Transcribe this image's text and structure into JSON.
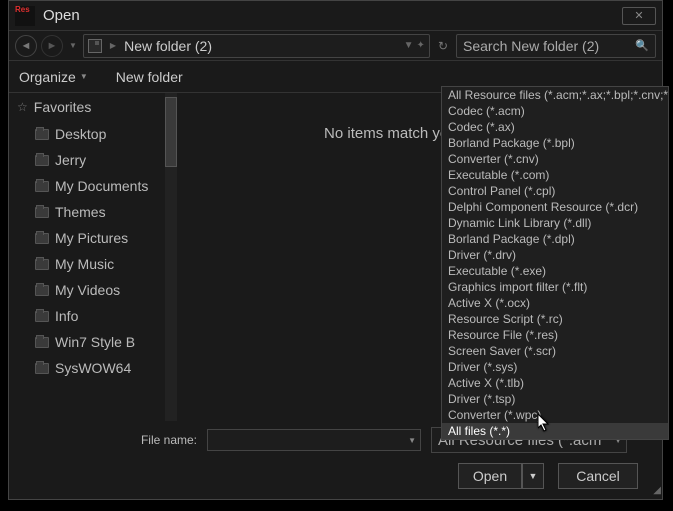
{
  "window": {
    "title": "Open"
  },
  "breadcrumb": {
    "location": "New folder (2)"
  },
  "search": {
    "placeholder": "Search New folder (2)"
  },
  "toolbar": {
    "organize": "Organize",
    "newfolder": "New folder"
  },
  "sidebar": {
    "header": "Favorites",
    "items": [
      {
        "label": "Desktop"
      },
      {
        "label": "Jerry"
      },
      {
        "label": "My Documents"
      },
      {
        "label": "Themes"
      },
      {
        "label": "My Pictures"
      },
      {
        "label": "My Music"
      },
      {
        "label": "My Videos"
      },
      {
        "label": "Info"
      },
      {
        "label": "Win7 Style B"
      },
      {
        "label": "SysWOW64"
      }
    ]
  },
  "main": {
    "empty": "No items match your search."
  },
  "footer": {
    "filename_label": "File name:",
    "filetype_selected": "All Resource files (*.acm",
    "open": "Open",
    "cancel": "Cancel"
  },
  "dropdown": {
    "items": [
      "All Resource files (*.acm;*.ax;*.bpl;*.cnv;*.co",
      "Codec (*.acm)",
      "Codec (*.ax)",
      "Borland Package (*.bpl)",
      "Converter (*.cnv)",
      "Executable (*.com)",
      "Control Panel (*.cpl)",
      "Delphi Component Resource (*.dcr)",
      "Dynamic Link Library (*.dll)",
      "Borland Package (*.dpl)",
      "Driver (*.drv)",
      "Executable (*.exe)",
      "Graphics import filter (*.flt)",
      "Active X (*.ocx)",
      "Resource Script (*.rc)",
      "Resource File (*.res)",
      "Screen Saver (*.scr)",
      "Driver (*.sys)",
      "Active X (*.tlb)",
      "Driver (*.tsp)",
      "Converter (*.wpc)",
      "All files (*.*)"
    ],
    "hover_index": 21
  }
}
